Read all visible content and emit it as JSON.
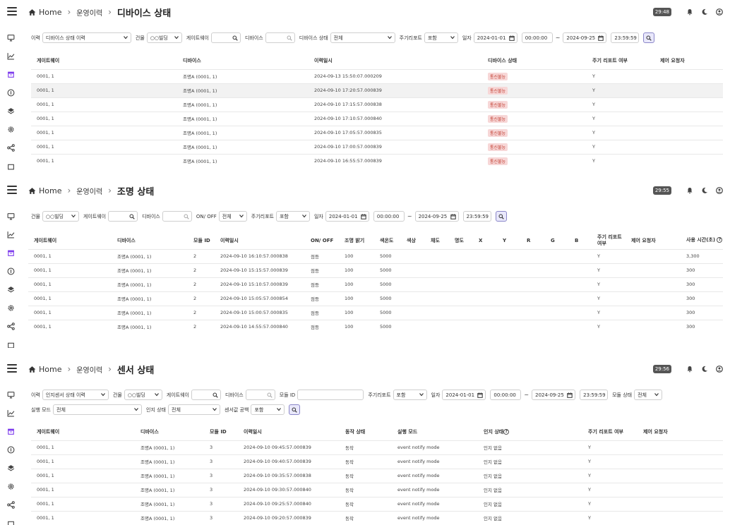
{
  "common": {
    "home": "Home",
    "breadcrumb_mid": "운영이력",
    "tilde": "~"
  },
  "panel1": {
    "title": "디바이스 상태",
    "timer": "29:48",
    "filters": {
      "history_label": "이력",
      "history_value": "디바이스 상태 이력",
      "building_label": "건물",
      "building_value": "○○빌딩",
      "gateway_label": "게이트웨이",
      "gateway_value": "",
      "device_label": "디바이스",
      "device_value": "",
      "status_label": "디바이스 상태",
      "status_value": "전체",
      "report_label": "주기리포트",
      "report_value": "포함",
      "date_label": "일자",
      "date_from": "2024-01-01",
      "time_from": "00:00:00",
      "date_to": "2024-09-25",
      "time_to": "23:59:59"
    },
    "columns": [
      "게이트웨이",
      "디바이스",
      "이력일시",
      "디바이스 상태",
      "주기 리포트 여부",
      "제어 요청자"
    ],
    "rows": [
      {
        "gw": "0001, 1",
        "dev": "조명A (0001, 1)",
        "dt": "2024-09-13 15:50:07.000209",
        "st": "통신불능",
        "rep": "Y",
        "req": ""
      },
      {
        "gw": "0001, 1",
        "dev": "조명A (0001, 1)",
        "dt": "2024-09-10 17:20:57.000839",
        "st": "통신불능",
        "rep": "Y",
        "req": ""
      },
      {
        "gw": "0001, 1",
        "dev": "조명A (0001, 1)",
        "dt": "2024-09-10 17:15:57.000838",
        "st": "통신불능",
        "rep": "Y",
        "req": ""
      },
      {
        "gw": "0001, 1",
        "dev": "조명A (0001, 1)",
        "dt": "2024-09-10 17:10:57.000840",
        "st": "통신불능",
        "rep": "Y",
        "req": ""
      },
      {
        "gw": "0001, 1",
        "dev": "조명A (0001, 1)",
        "dt": "2024-09-10 17:05:57.000835",
        "st": "통신불능",
        "rep": "Y",
        "req": ""
      },
      {
        "gw": "0001, 1",
        "dev": "조명A (0001, 1)",
        "dt": "2024-09-10 17:00:57.000839",
        "st": "통신불능",
        "rep": "Y",
        "req": ""
      },
      {
        "gw": "0001, 1",
        "dev": "조명A (0001, 1)",
        "dt": "2024-09-10 16:55:57.000839",
        "st": "통신불능",
        "rep": "Y",
        "req": ""
      }
    ]
  },
  "panel2": {
    "title": "조명 상태",
    "timer": "29:55",
    "filters": {
      "building_label": "건물",
      "building_value": "○○빌딩",
      "gateway_label": "게이트웨이",
      "gateway_value": "",
      "device_label": "디바이스",
      "device_value": "",
      "onoff_label": "ON/ OFF",
      "onoff_value": "전체",
      "report_label": "주기리포트",
      "report_value": "포함",
      "date_label": "일자",
      "date_from": "2024-01-01",
      "time_from": "00:00:00",
      "date_to": "2024-09-25",
      "time_to": "23:59:59"
    },
    "columns": [
      "게이트웨이",
      "디바이스",
      "모듈 ID",
      "이력일시",
      "ON/ OFF",
      "조명 밝기",
      "색온도",
      "색상",
      "채도",
      "명도",
      "X",
      "Y",
      "R",
      "G",
      "B",
      "주기 리포트 여부",
      "제어 요청자",
      "사용 시간(초)"
    ],
    "rows": [
      {
        "gw": "0001, 1",
        "dev": "조명A (0001, 1)",
        "mod": "2",
        "dt": "2024-09-10 16:10:57.000838",
        "onoff": "점등",
        "bri": "100",
        "ct": "5000",
        "rep": "Y",
        "use": "3,300"
      },
      {
        "gw": "0001, 1",
        "dev": "조명A (0001, 1)",
        "mod": "2",
        "dt": "2024-09-10 15:15:57.000839",
        "onoff": "점등",
        "bri": "100",
        "ct": "5000",
        "rep": "Y",
        "use": "300"
      },
      {
        "gw": "0001, 1",
        "dev": "조명A (0001, 1)",
        "mod": "2",
        "dt": "2024-09-10 15:10:57.000839",
        "onoff": "점등",
        "bri": "100",
        "ct": "5000",
        "rep": "Y",
        "use": "300"
      },
      {
        "gw": "0001, 1",
        "dev": "조명A (0001, 1)",
        "mod": "2",
        "dt": "2024-09-10 15:05:57.000854",
        "onoff": "점등",
        "bri": "100",
        "ct": "5000",
        "rep": "Y",
        "use": "300"
      },
      {
        "gw": "0001, 1",
        "dev": "조명A (0001, 1)",
        "mod": "2",
        "dt": "2024-09-10 15:00:57.000835",
        "onoff": "점등",
        "bri": "100",
        "ct": "5000",
        "rep": "Y",
        "use": "300"
      },
      {
        "gw": "0001, 1",
        "dev": "조명A (0001, 1)",
        "mod": "2",
        "dt": "2024-09-10 14:55:57.000840",
        "onoff": "점등",
        "bri": "100",
        "ct": "5000",
        "rep": "Y",
        "use": "300"
      }
    ]
  },
  "panel3": {
    "title": "센서 상태",
    "timer": "29:56",
    "filters": {
      "history_label": "이력",
      "history_value": "인지센서 상태 이력",
      "building_label": "건물",
      "building_value": "○○빌딩",
      "gateway_label": "게이트웨이",
      "gateway_value": "",
      "device_label": "디바이스",
      "device_value": "",
      "module_label": "모듈 ID",
      "module_value": "",
      "report_label": "주기리포트",
      "report_value": "포함",
      "date_label": "일자",
      "date_from": "2024-01-01",
      "time_from": "00:00:00",
      "date_to": "2024-09-25",
      "time_to": "23:59:59",
      "modstate_label": "모듈 상태",
      "modstate_value": "전체",
      "runmode_label": "실행 모드",
      "runmode_value": "전체",
      "sense_label": "인지 상태",
      "sense_value": "전체",
      "gap_label": "센서값 공백",
      "gap_value": "포함"
    },
    "columns": [
      "게이트웨이",
      "디바이스",
      "모듈 ID",
      "이력일시",
      "동작 상태",
      "실행 모드",
      "인지 상태",
      "주기 리포트 여부",
      "제어 요청자"
    ],
    "rows": [
      {
        "gw": "0001, 1",
        "dev": "조명A (0001, 1)",
        "mod": "3",
        "dt": "2024-09-10 09:45:57.000839",
        "act": "동작",
        "mode": "event notify mode",
        "sense": "인지 없음",
        "rep": "Y"
      },
      {
        "gw": "0001, 1",
        "dev": "조명A (0001, 1)",
        "mod": "3",
        "dt": "2024-09-10 09:40:57.000839",
        "act": "동작",
        "mode": "event notify mode",
        "sense": "인지 없음",
        "rep": "Y"
      },
      {
        "gw": "0001, 1",
        "dev": "조명A (0001, 1)",
        "mod": "3",
        "dt": "2024-09-10 09:35:57.000838",
        "act": "동작",
        "mode": "event notify mode",
        "sense": "인지 없음",
        "rep": "Y"
      },
      {
        "gw": "0001, 1",
        "dev": "조명A (0001, 1)",
        "mod": "3",
        "dt": "2024-09-10 09:30:57.000840",
        "act": "동작",
        "mode": "event notify mode",
        "sense": "인지 없음",
        "rep": "Y"
      },
      {
        "gw": "0001, 1",
        "dev": "조명A (0001, 1)",
        "mod": "3",
        "dt": "2024-09-10 09:25:57.000840",
        "act": "동작",
        "mode": "event notify mode",
        "sense": "인지 없음",
        "rep": "Y"
      },
      {
        "gw": "0001, 1",
        "dev": "조명A (0001, 1)",
        "mod": "3",
        "dt": "2024-09-10 09:20:57.000839",
        "act": "동작",
        "mode": "event notify mode",
        "sense": "인지 없음",
        "rep": "Y"
      }
    ]
  }
}
